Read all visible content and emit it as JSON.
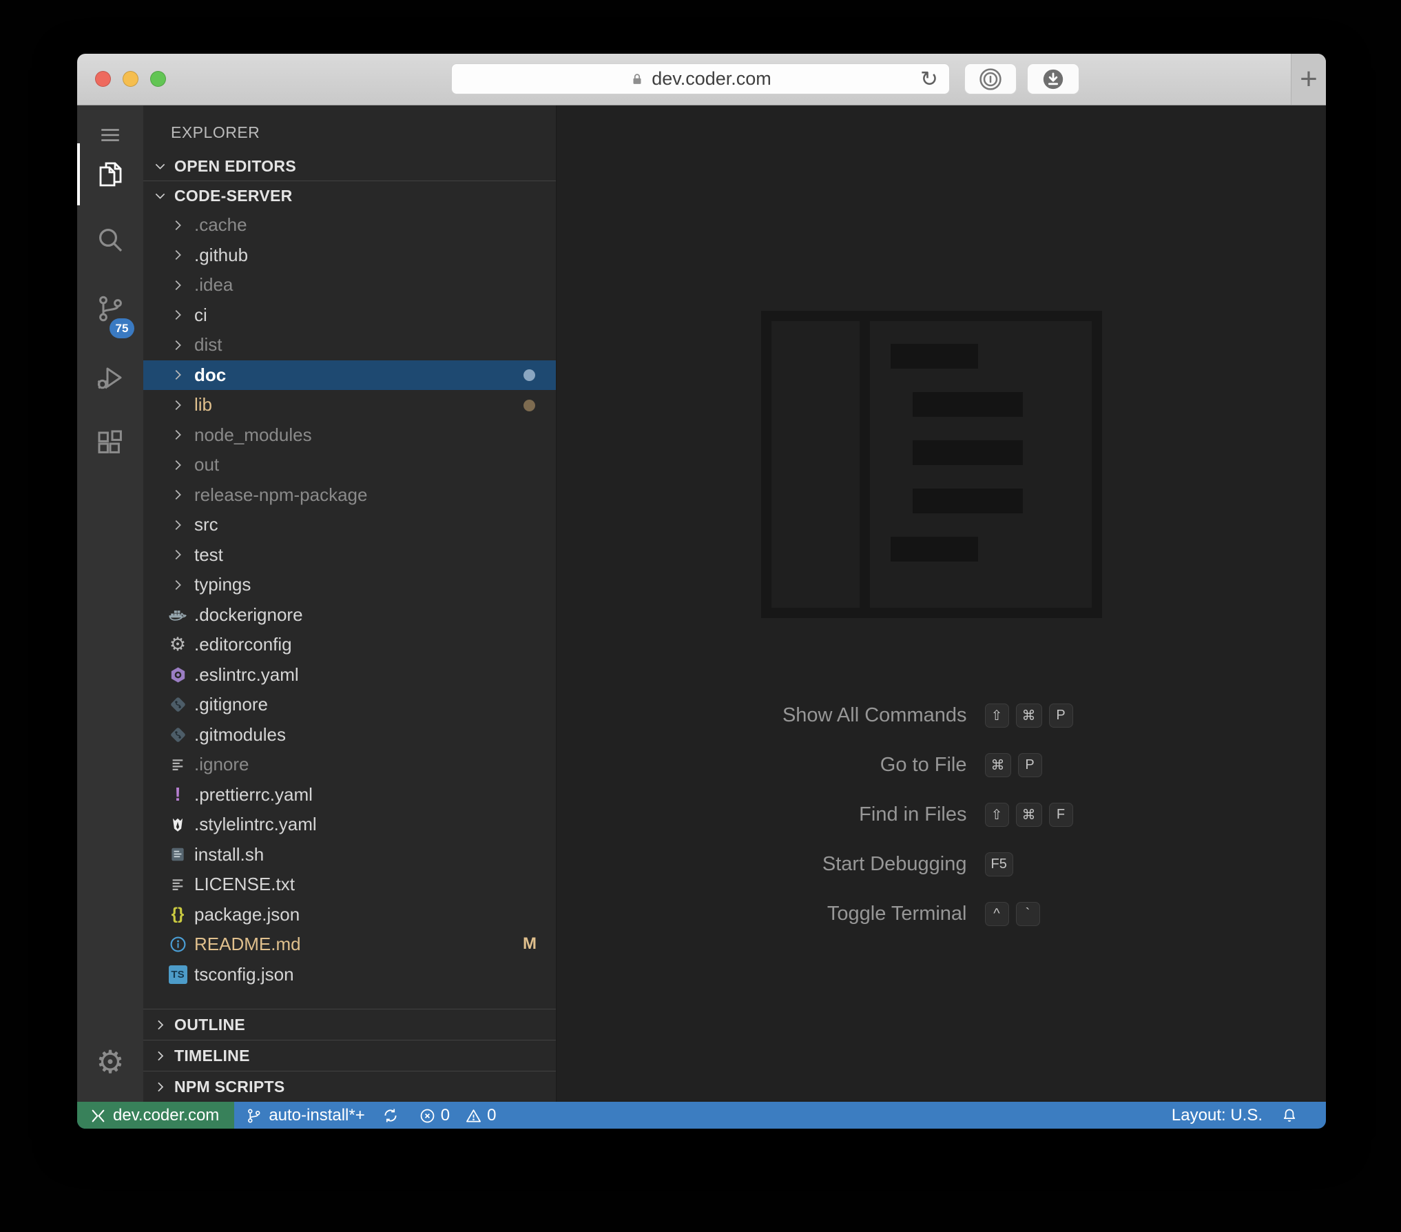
{
  "browser": {
    "url": "dev.coder.com",
    "reload_glyph": "↻",
    "new_tab_label": "+"
  },
  "activity_bar": {
    "scm_badge": "75"
  },
  "explorer": {
    "title": "EXPLORER",
    "open_editors_label": "OPEN EDITORS",
    "root_label": "CODE-SERVER",
    "bottom_sections": [
      "OUTLINE",
      "TIMELINE",
      "NPM SCRIPTS"
    ],
    "items": [
      {
        "name": ".cache",
        "kind": "folder",
        "state": "ignored"
      },
      {
        "name": ".github",
        "kind": "folder",
        "state": "normal"
      },
      {
        "name": ".idea",
        "kind": "folder",
        "state": "ignored"
      },
      {
        "name": "ci",
        "kind": "folder",
        "state": "normal"
      },
      {
        "name": "dist",
        "kind": "folder",
        "state": "ignored"
      },
      {
        "name": "doc",
        "kind": "folder",
        "state": "selected",
        "dot": "#8aa6c1"
      },
      {
        "name": "lib",
        "kind": "folder",
        "state": "modified",
        "dot": "#7d6b50"
      },
      {
        "name": "node_modules",
        "kind": "folder",
        "state": "ignored"
      },
      {
        "name": "out",
        "kind": "folder",
        "state": "ignored"
      },
      {
        "name": "release-npm-package",
        "kind": "folder",
        "state": "ignored"
      },
      {
        "name": "src",
        "kind": "folder",
        "state": "normal"
      },
      {
        "name": "test",
        "kind": "folder",
        "state": "normal"
      },
      {
        "name": "typings",
        "kind": "folder",
        "state": "normal"
      },
      {
        "name": ".dockerignore",
        "kind": "file",
        "icon": "docker-icon",
        "state": "normal"
      },
      {
        "name": ".editorconfig",
        "kind": "file",
        "icon": "gear-small-icon",
        "state": "normal"
      },
      {
        "name": ".eslintrc.yaml",
        "kind": "file",
        "icon": "eslint-icon",
        "state": "normal"
      },
      {
        "name": ".gitignore",
        "kind": "file",
        "icon": "git-icon",
        "state": "normal"
      },
      {
        "name": ".gitmodules",
        "kind": "file",
        "icon": "git-icon",
        "state": "normal"
      },
      {
        "name": ".ignore",
        "kind": "file",
        "icon": "list-icon",
        "state": "ignored"
      },
      {
        "name": ".prettierrc.yaml",
        "kind": "file",
        "icon": "exclamation-icon",
        "state": "normal"
      },
      {
        "name": ".stylelintrc.yaml",
        "kind": "file",
        "icon": "stylelint-icon",
        "state": "normal"
      },
      {
        "name": "install.sh",
        "kind": "file",
        "icon": "shell-icon",
        "state": "normal"
      },
      {
        "name": "LICENSE.txt",
        "kind": "file",
        "icon": "list-icon",
        "state": "normal"
      },
      {
        "name": "package.json",
        "kind": "file",
        "icon": "braces-icon",
        "state": "normal"
      },
      {
        "name": "README.md",
        "kind": "file",
        "icon": "info-icon",
        "state": "modified",
        "badge": "M"
      },
      {
        "name": "tsconfig.json",
        "kind": "file",
        "icon": "ts-icon",
        "state": "normal"
      }
    ]
  },
  "editor": {
    "shortcuts": [
      {
        "label": "Show All Commands",
        "keys": [
          "⇧",
          "⌘",
          "P"
        ]
      },
      {
        "label": "Go to File",
        "keys": [
          "⌘",
          "P"
        ]
      },
      {
        "label": "Find in Files",
        "keys": [
          "⇧",
          "⌘",
          "F"
        ]
      },
      {
        "label": "Start Debugging",
        "keys": [
          "F5"
        ]
      },
      {
        "label": "Toggle Terminal",
        "keys": [
          "^",
          "`"
        ]
      }
    ]
  },
  "status_bar": {
    "remote": "dev.coder.com",
    "branch": "auto-install*+",
    "errors": "0",
    "warnings": "0",
    "layout": "Layout: U.S."
  },
  "colors": {
    "selection_bg": "#1e4971",
    "modified_text": "#e0c08d",
    "ignored_text": "#8a8a8a",
    "normal_text": "#d6d6d6",
    "scm_badge_bg": "#3a7ac2",
    "status_blue": "#3c7dc1",
    "status_green": "#38815a",
    "doc_dot": "#8aa6c1",
    "lib_dot": "#7d6b50"
  }
}
